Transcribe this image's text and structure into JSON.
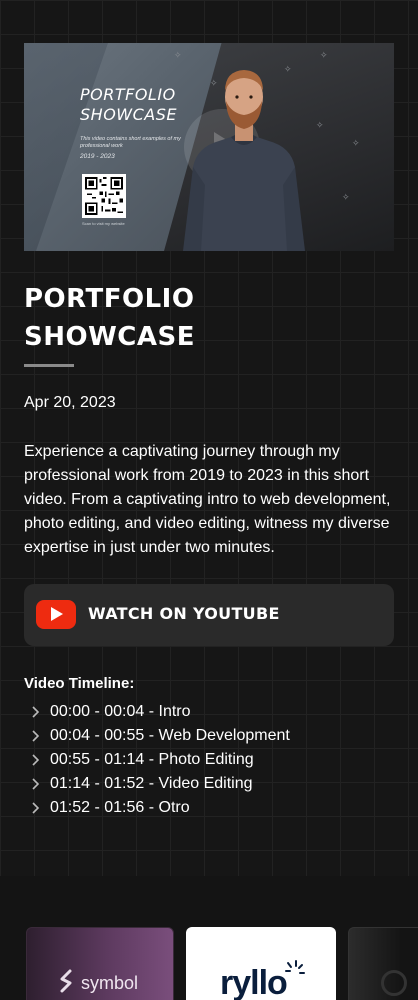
{
  "hero": {
    "title": "PORTFOLIO SHOWCASE",
    "subtitle": "This video contains short examples of my professional work",
    "years": "2019 - 2023",
    "qr_caption": "Scan to visit my website"
  },
  "page": {
    "title": "PORTFOLIO SHOWCASE",
    "date": "Apr 20, 2023",
    "description": "Experience a captivating journey through my professional work from 2019 to 2023 in this short video. From a captivating intro to web development, photo editing, and video editing, witness my diverse expertise in just under two minutes."
  },
  "youtube": {
    "label": "WATCH ON YOUTUBE",
    "icon": "youtube-play-icon",
    "color": "#ee2b10"
  },
  "timeline": {
    "heading": "Video Timeline:",
    "items": [
      "00:00 - 00:04 - Intro",
      "00:04 - 00:55 - Web Development",
      "00:55 - 01:14 - Photo Editing",
      "01:14 - 01:52 - Video Editing",
      "01:52 - 01:56 - Otro"
    ]
  },
  "cards": {
    "symbol": "symbol",
    "ryllo": "ryllo"
  }
}
